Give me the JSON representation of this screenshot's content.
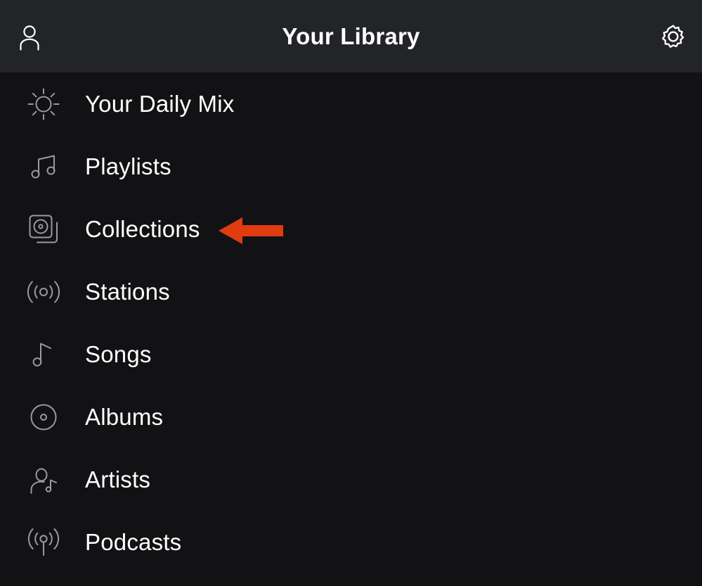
{
  "header": {
    "title": "Your Library",
    "profile_icon": "person-icon",
    "settings_icon": "gear-icon",
    "background_color": "#232427"
  },
  "page": {
    "background_color": "#121214",
    "text_color": "#ffffff",
    "icon_color": "#9a9a9e"
  },
  "library": {
    "items": [
      {
        "label": "Your Daily Mix",
        "icon": "sun-icon"
      },
      {
        "label": "Playlists",
        "icon": "music-notes-icon"
      },
      {
        "label": "Collections",
        "icon": "stacked-albums-icon"
      },
      {
        "label": "Stations",
        "icon": "radio-waves-icon"
      },
      {
        "label": "Songs",
        "icon": "music-note-icon"
      },
      {
        "label": "Albums",
        "icon": "vinyl-disc-icon"
      },
      {
        "label": "Artists",
        "icon": "person-with-note-icon"
      },
      {
        "label": "Podcasts",
        "icon": "broadcast-antenna-icon"
      }
    ]
  },
  "annotation": {
    "type": "arrow-left",
    "target_label": "Collections",
    "color": "#e03c10"
  }
}
